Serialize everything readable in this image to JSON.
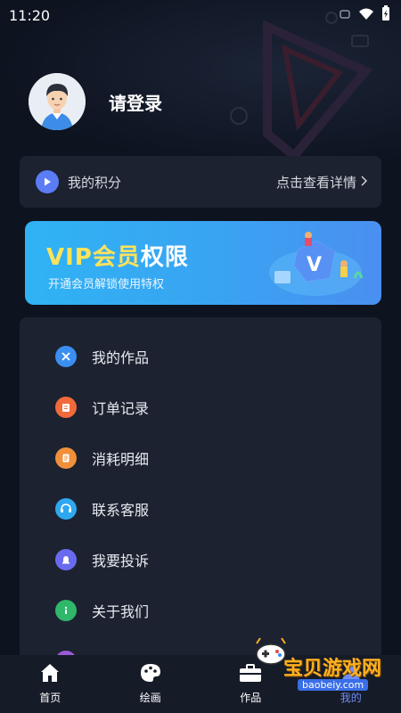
{
  "status_bar": {
    "time": "11:20",
    "icons": [
      "notification-icon",
      "wifi-icon",
      "battery-charging-icon"
    ]
  },
  "profile": {
    "avatar_icon": "avatar-boy",
    "login_text": "请登录"
  },
  "points": {
    "label": "我的积分",
    "link_text": "点击查看详情",
    "icon": "play-circle-icon",
    "accent": "#5b7cf5"
  },
  "vip": {
    "title_prefix": "VIP会员",
    "title_suffix": "权限",
    "subtitle": "开通会员解锁使用特权",
    "badge_letter": "V"
  },
  "menu": {
    "items": [
      {
        "label": "我的作品",
        "icon": "works-icon",
        "color": "#3b8ff0"
      },
      {
        "label": "订单记录",
        "icon": "order-icon",
        "color": "#f06a3a"
      },
      {
        "label": "消耗明细",
        "icon": "consumption-icon",
        "color": "#f0903a"
      },
      {
        "label": "联系客服",
        "icon": "customer-service-icon",
        "color": "#2fa8f0"
      },
      {
        "label": "我要投诉",
        "icon": "complaint-icon",
        "color": "#6a6af0"
      },
      {
        "label": "关于我们",
        "icon": "about-icon",
        "color": "#2fb86a"
      }
    ]
  },
  "tabbar": {
    "tabs": [
      {
        "label": "首页",
        "icon": "home-icon"
      },
      {
        "label": "绘画",
        "icon": "palette-icon"
      },
      {
        "label": "作品",
        "icon": "toolbox-icon"
      },
      {
        "label": "我的",
        "icon": "profile-icon",
        "active": true
      }
    ]
  },
  "watermark": {
    "text": "宝贝游戏网",
    "url": "baobeiy.com"
  }
}
